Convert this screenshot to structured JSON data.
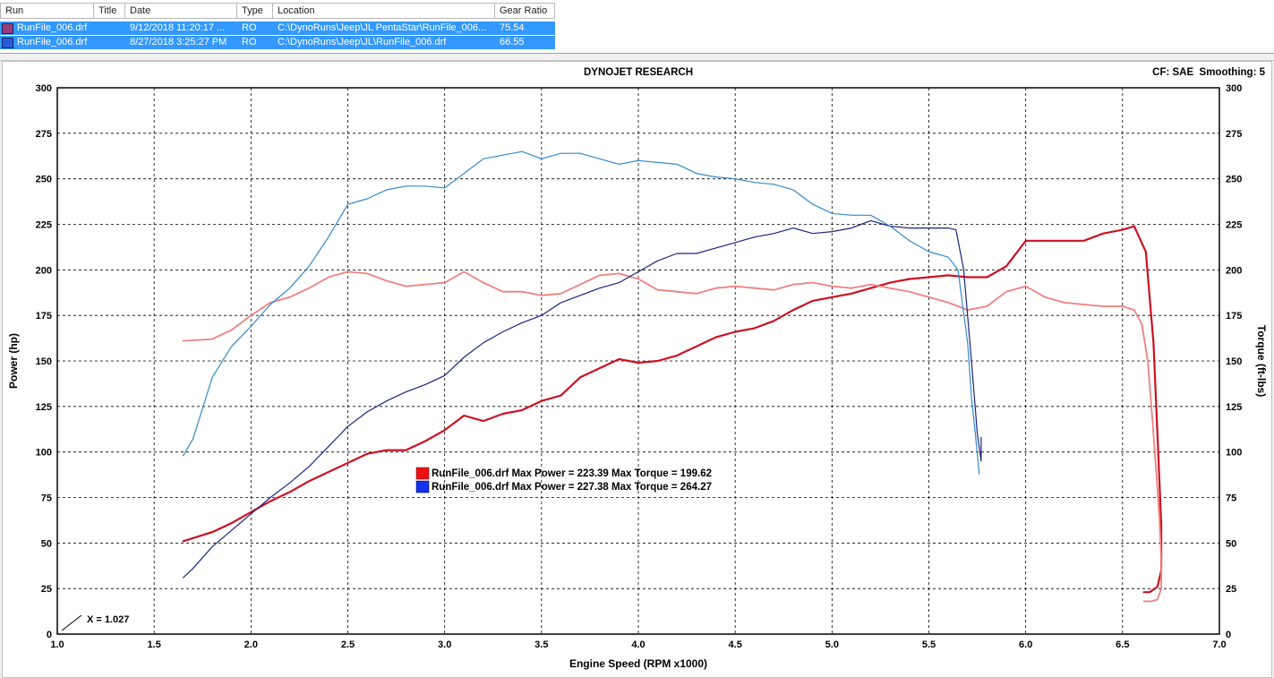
{
  "run_table": {
    "columns": [
      "Run",
      "Title",
      "Date",
      "Type",
      "Location",
      "Gear Ratio"
    ],
    "rows": [
      {
        "run": "RunFile_006.drf",
        "title": "",
        "date": "9/12/2018 11:20:17 ...",
        "type": "RO",
        "location": "C:\\DynoRuns\\Jeep\\JL PentaStar\\RunFile_006...",
        "gear_ratio": "75.54",
        "swatch": "#9b3b7a"
      },
      {
        "run": "RunFile_006.drf",
        "title": "",
        "date": "8/27/2018 3:25:27 PM",
        "type": "RO",
        "location": "C:\\DynoRuns\\Jeep\\JL\\RunFile_006.drf",
        "gear_ratio": "66.55",
        "swatch": "#2a5bd7"
      }
    ]
  },
  "chart_data": {
    "type": "line",
    "title": "DYNOJET RESEARCH",
    "corner_info": "CF: SAE  Smoothing: 5",
    "xlabel": "Engine Speed (RPM x1000)",
    "ylabel_left": "Power (hp)",
    "ylabel_right": "Torque (ft-lbs)",
    "xlim": [
      1.0,
      7.0
    ],
    "ylim": [
      0,
      300
    ],
    "xticks": [
      "1.0",
      "1.5",
      "2.0",
      "2.5",
      "3.0",
      "3.5",
      "4.0",
      "4.5",
      "5.0",
      "5.5",
      "6.0",
      "6.5",
      "7.0"
    ],
    "yticks": [
      "0",
      "25",
      "50",
      "75",
      "100",
      "125",
      "150",
      "175",
      "200",
      "225",
      "250",
      "275",
      "300"
    ],
    "grid": true,
    "x_annotation": "X = 1.027",
    "legend": [
      {
        "label": "RunFile_006.drf Max Power = 223.39 Max Torque = 199.62",
        "color": "#ee1111"
      },
      {
        "label": "RunFile_006.drf Max Power = 227.38 Max Torque = 264.27",
        "color": "#1133ee"
      }
    ],
    "series": [
      {
        "color": "#cc1122",
        "width": 2.2,
        "x": [
          1.65,
          1.8,
          1.9,
          2.0,
          2.1,
          2.2,
          2.3,
          2.4,
          2.5,
          2.6,
          2.7,
          2.8,
          2.9,
          3.0,
          3.1,
          3.2,
          3.3,
          3.4,
          3.5,
          3.6,
          3.7,
          3.8,
          3.9,
          4.0,
          4.1,
          4.2,
          4.3,
          4.4,
          4.5,
          4.6,
          4.7,
          4.8,
          4.9,
          5.0,
          5.1,
          5.2,
          5.3,
          5.4,
          5.5,
          5.6,
          5.7,
          5.8,
          5.9,
          6.0,
          6.1,
          6.2,
          6.3,
          6.4,
          6.5,
          6.56,
          6.62,
          6.66,
          6.68,
          6.7,
          6.7,
          6.68,
          6.64,
          6.61
        ],
        "y": [
          51,
          56,
          61,
          67,
          73,
          78,
          84,
          89,
          94,
          99,
          101,
          101,
          106,
          112,
          120,
          117,
          121,
          123,
          128,
          131,
          141,
          146,
          151,
          149,
          150,
          153,
          158,
          163,
          166,
          168,
          172,
          178,
          183,
          185,
          187,
          190,
          193,
          195,
          196,
          197,
          196,
          196,
          202,
          216,
          216,
          216,
          216,
          220,
          222,
          224,
          210,
          160,
          110,
          60,
          35,
          26,
          23,
          23
        ]
      },
      {
        "color": "#f08080",
        "width": 1.8,
        "x": [
          1.65,
          1.8,
          1.9,
          2.0,
          2.1,
          2.2,
          2.3,
          2.4,
          2.5,
          2.6,
          2.7,
          2.8,
          2.9,
          3.0,
          3.1,
          3.2,
          3.3,
          3.4,
          3.5,
          3.6,
          3.7,
          3.8,
          3.9,
          4.0,
          4.1,
          4.2,
          4.3,
          4.4,
          4.5,
          4.6,
          4.7,
          4.8,
          4.9,
          5.0,
          5.1,
          5.2,
          5.3,
          5.4,
          5.5,
          5.6,
          5.7,
          5.8,
          5.9,
          6.0,
          6.1,
          6.2,
          6.3,
          6.4,
          6.5,
          6.56,
          6.6,
          6.63,
          6.66,
          6.69,
          6.7,
          6.7,
          6.68,
          6.65,
          6.61
        ],
        "y": [
          161,
          162,
          167,
          175,
          182,
          185,
          190,
          196,
          199,
          198,
          194,
          191,
          192,
          193,
          199,
          193,
          188,
          188,
          186,
          187,
          192,
          197,
          198,
          195,
          189,
          188,
          187,
          190,
          191,
          190,
          189,
          192,
          193,
          191,
          190,
          192,
          190,
          188,
          185,
          182,
          178,
          180,
          188,
          191,
          185,
          182,
          181,
          180,
          180,
          178,
          170,
          150,
          110,
          65,
          40,
          25,
          19,
          18,
          18
        ]
      },
      {
        "color": "#1a237e",
        "width": 1.2,
        "x": [
          1.65,
          1.7,
          1.8,
          1.9,
          2.0,
          2.1,
          2.2,
          2.3,
          2.4,
          2.5,
          2.6,
          2.7,
          2.8,
          2.9,
          3.0,
          3.1,
          3.2,
          3.3,
          3.4,
          3.5,
          3.6,
          3.7,
          3.8,
          3.9,
          4.0,
          4.1,
          4.2,
          4.3,
          4.4,
          4.5,
          4.6,
          4.7,
          4.8,
          4.9,
          5.0,
          5.1,
          5.2,
          5.3,
          5.4,
          5.5,
          5.6,
          5.64,
          5.68,
          5.72,
          5.75,
          5.77,
          5.77
        ],
        "y": [
          31,
          36,
          48,
          57,
          66,
          75,
          83,
          92,
          103,
          114,
          122,
          128,
          133,
          137,
          142,
          152,
          160,
          166,
          171,
          175,
          182,
          186,
          190,
          193,
          199,
          205,
          209,
          209,
          212,
          215,
          218,
          220,
          223,
          220,
          221,
          223,
          227,
          224,
          223,
          223,
          223,
          222,
          200,
          150,
          110,
          95,
          108
        ]
      },
      {
        "color": "#3388cc",
        "width": 1.2,
        "x": [
          1.65,
          1.7,
          1.75,
          1.8,
          1.9,
          2.0,
          2.1,
          2.2,
          2.3,
          2.4,
          2.5,
          2.6,
          2.7,
          2.8,
          2.9,
          3.0,
          3.1,
          3.2,
          3.3,
          3.4,
          3.5,
          3.6,
          3.7,
          3.8,
          3.9,
          4.0,
          4.1,
          4.2,
          4.3,
          4.4,
          4.5,
          4.6,
          4.7,
          4.8,
          4.9,
          5.0,
          5.1,
          5.2,
          5.3,
          5.4,
          5.5,
          5.6,
          5.65,
          5.7,
          5.72,
          5.74,
          5.76
        ],
        "y": [
          98,
          107,
          124,
          141,
          158,
          169,
          181,
          190,
          202,
          218,
          236,
          239,
          244,
          246,
          246,
          245,
          253,
          261,
          263,
          265,
          261,
          264,
          264,
          261,
          258,
          260,
          259,
          258,
          253,
          251,
          250,
          248,
          247,
          244,
          236,
          231,
          230,
          230,
          224,
          216,
          210,
          207,
          200,
          160,
          130,
          110,
          88
        ]
      }
    ]
  }
}
